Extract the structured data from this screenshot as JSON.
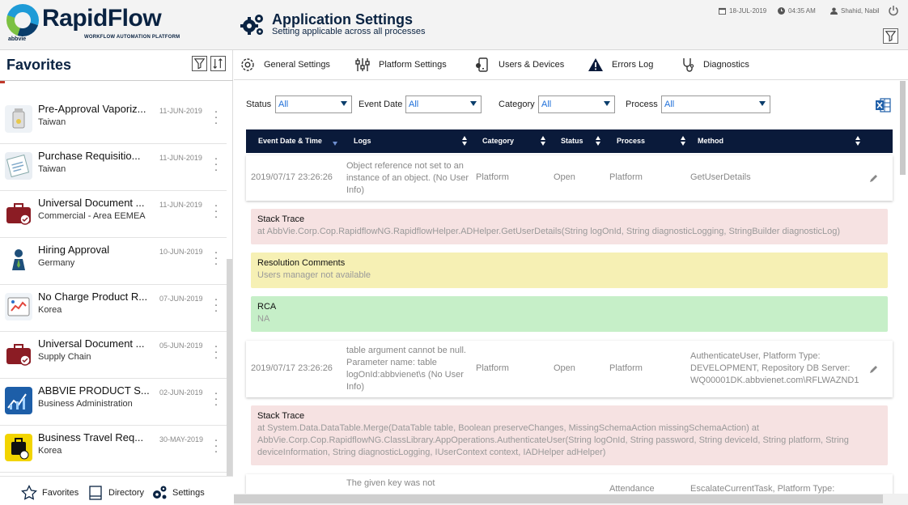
{
  "brand": {
    "name": "RapidFlow",
    "tagline": "WORKFLOW AUTOMATION PLATFORM",
    "parent": "abbvie"
  },
  "header": {
    "title": "Application Settings",
    "subtitle": "Setting applicable across all processes",
    "date": "18-JUL-2019",
    "time": "04:35 AM",
    "user": "Shahid, Nabil"
  },
  "sidebar": {
    "title": "Favorites",
    "items": [
      {
        "name": "Pre-Approval Vaporiz...",
        "sub": "Taiwan",
        "date": "11-JUN-2019",
        "icon": "vaporizer-icon"
      },
      {
        "name": "Purchase Requisitio...",
        "sub": "Taiwan",
        "date": "11-JUN-2019",
        "icon": "requisition-icon"
      },
      {
        "name": "Universal Document ...",
        "sub": "Commercial - Area EEMEA",
        "date": "11-JUN-2019",
        "icon": "briefcase-icon"
      },
      {
        "name": "Hiring Approval",
        "sub": "Germany",
        "date": "10-JUN-2019",
        "icon": "hiring-icon"
      },
      {
        "name": "No Charge Product R...",
        "sub": "Korea",
        "date": "07-JUN-2019",
        "icon": "product-icon"
      },
      {
        "name": "Universal Document ...",
        "sub": "Supply Chain",
        "date": "05-JUN-2019",
        "icon": "briefcase-icon"
      },
      {
        "name": "ABBVIE PRODUCT S...",
        "sub": "Business Administration",
        "date": "02-JUN-2019",
        "icon": "chart-icon"
      },
      {
        "name": "Business Travel Req...",
        "sub": "Korea",
        "date": "30-MAY-2019",
        "icon": "travel-icon"
      }
    ],
    "footer": {
      "favorites": "Favorites",
      "directory": "Directory",
      "settings": "Settings"
    }
  },
  "tabs": [
    "General Settings",
    "Platform Settings",
    "Users & Devices",
    "Errors Log",
    "Diagnostics"
  ],
  "filters": {
    "status_label": "Status",
    "status_value": "All",
    "event_date_label": "Event Date",
    "event_date_value": "All",
    "category_label": "Category",
    "category_value": "All",
    "process_label": "Process",
    "process_value": "All"
  },
  "table": {
    "columns": [
      "Event Date & Time",
      "Logs",
      "Category",
      "Status",
      "Process",
      "Method"
    ],
    "rows": [
      {
        "datetime": "2019/07/17 23:26:26",
        "log": "Object reference not set to an instance of an object. (No User Info)",
        "category": "Platform",
        "status": "Open",
        "process": "Platform",
        "method": "GetUserDetails",
        "stack_trace_title": "Stack Trace",
        "stack_trace": "at AbbVie.Corp.Cop.RapidflowNG.RapidflowHelper.ADHelper.GetUserDetails(String logOnId, String diagnosticLogging, StringBuilder diagnosticLog)",
        "resolution_title": "Resolution Comments",
        "resolution": "Users manager not available",
        "rca_title": "RCA",
        "rca": "NA"
      },
      {
        "datetime": "2019/07/17 23:26:26",
        "log": "table argument cannot be null. Parameter name: table logOnId:abbvienet\\s (No User Info)",
        "category": "Platform",
        "status": "Open",
        "process": "Platform",
        "method": "AuthenticateUser, Platform Type: DEVELOPMENT, Repository DB Server: WQ00001DK.abbvienet.com\\RFLWAZND1",
        "stack_trace_title": "Stack Trace",
        "stack_trace": "at System.Data.DataTable.Merge(DataTable table, Boolean preserveChanges, MissingSchemaAction missingSchemaAction) at AbbVie.Corp.Cop.RapidflowNG.ClassLibrary.AppOperations.AuthenticateUser(String logOnId, String password, String deviceId, String platform, String deviceInformation, String diagnosticLogging, IUserContext context, IADHelper adHelper)"
      },
      {
        "log": "The given key was not",
        "process": "Attendance",
        "method": "EscalateCurrentTask, Platform Type:"
      }
    ]
  },
  "colors": {
    "navy": "#0a1a3a",
    "brand": "#0a2342",
    "accent": "#1e6fd9"
  }
}
